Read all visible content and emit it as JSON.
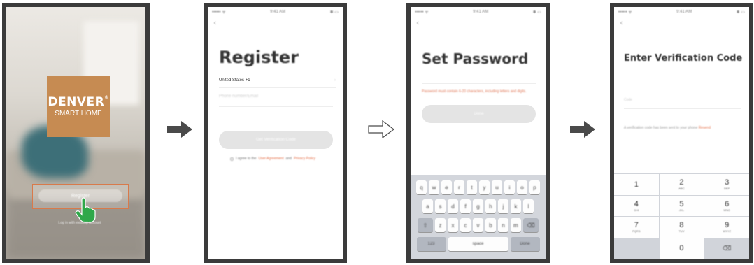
{
  "screen1": {
    "status_bar": "",
    "logo": {
      "brand": "DENVER",
      "reg_mark": "®",
      "subtitle": "SMART HOME",
      "color": "#c68b52"
    },
    "register_button": "Register",
    "login_link": "Log in with existing account",
    "pointer_icon": "hand-pointer-icon"
  },
  "arrows": [
    {
      "style": "filled",
      "color": "#4a4a4a"
    },
    {
      "style": "outline",
      "color": "#4a4a4a"
    },
    {
      "style": "filled",
      "color": "#4a4a4a"
    }
  ],
  "screen2": {
    "status_bar": {
      "left": "•••••• ᯤ",
      "center": "9:41 AM",
      "right": "✱ ▭"
    },
    "back_icon": "‹",
    "title": "Register",
    "country": "United States +1",
    "country_chevron": "›",
    "phone_placeholder": "Phone number/Email",
    "get_code_button": "Get Verification Code",
    "agreement_prefix": "I agree to the",
    "agreement_service": "User Agreement",
    "agreement_and": "and",
    "agreement_privacy": "Privacy Policy"
  },
  "screen3": {
    "status_bar": {
      "left": "•••••• ᯤ",
      "center": "9:41 AM",
      "right": "✱ ▭"
    },
    "back_icon": "‹",
    "title": "Set Password",
    "password_placeholder": "",
    "hint": "Password must contain 6-20 characters, including letters and digits.",
    "done_button": "Done",
    "keyboard_rows": [
      [
        "q",
        "w",
        "e",
        "r",
        "t",
        "y",
        "u",
        "i",
        "o",
        "p"
      ],
      [
        "a",
        "s",
        "d",
        "f",
        "g",
        "h",
        "j",
        "k",
        "l"
      ],
      [
        "⇧",
        "z",
        "x",
        "c",
        "v",
        "b",
        "n",
        "m",
        "⌫"
      ]
    ],
    "keyboard_bottom": {
      "numbers": "123",
      "space": "space",
      "return": "Done"
    }
  },
  "screen4": {
    "status_bar": {
      "left": "•••••• ᯤ",
      "center": "9:41 AM",
      "right": "✱ ▭"
    },
    "back_icon": "‹",
    "title": "Enter Verification Code",
    "code_label": "Code",
    "info": "A verification code has been sent to your phone",
    "info_link": "Resend",
    "keys": [
      {
        "digit": "1",
        "letters": ""
      },
      {
        "digit": "2",
        "letters": "ABC"
      },
      {
        "digit": "3",
        "letters": "DEF"
      },
      {
        "digit": "4",
        "letters": "GHI"
      },
      {
        "digit": "5",
        "letters": "JKL"
      },
      {
        "digit": "6",
        "letters": "MNO"
      },
      {
        "digit": "7",
        "letters": "PQRS"
      },
      {
        "digit": "8",
        "letters": "TUV"
      },
      {
        "digit": "9",
        "letters": "WXYZ"
      },
      {
        "digit": "",
        "letters": ""
      },
      {
        "digit": "0",
        "letters": ""
      },
      {
        "digit": "⌫",
        "letters": ""
      }
    ]
  }
}
